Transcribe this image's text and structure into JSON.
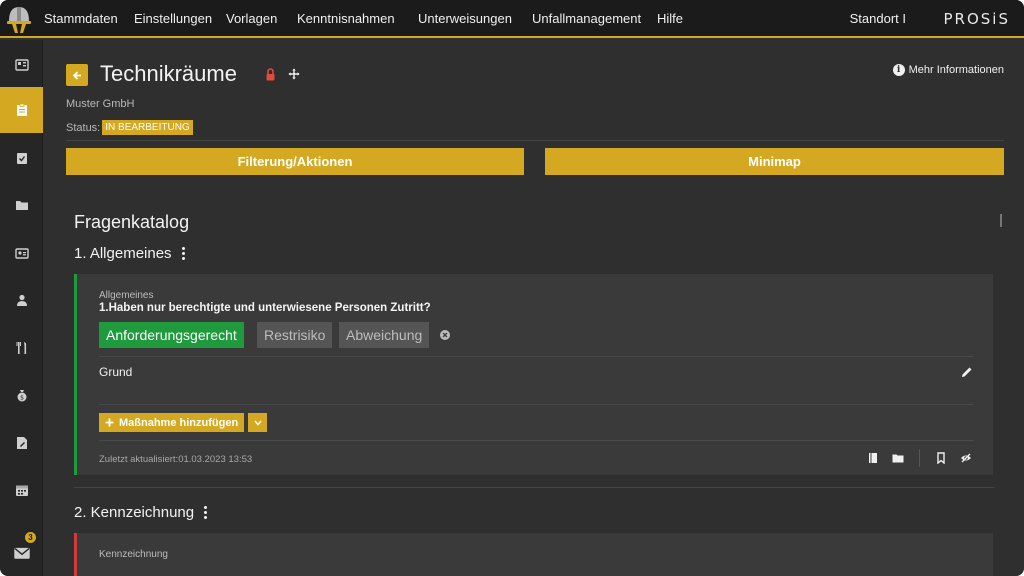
{
  "topbar": {
    "nav": [
      "Stammdaten",
      "Einstellungen",
      "Vorlagen",
      "Kenntnisnahmen",
      "Unterweisungen",
      "Unfallmanagement",
      "Hilfe"
    ],
    "location": "Standort I",
    "brand": "PROSiS"
  },
  "sidebar": {
    "items": [
      "dashboard-icon",
      "clipboard-icon",
      "clipboard-check-icon",
      "folder-icon",
      "id-card-icon",
      "person-icon",
      "tools-icon",
      "money-bag-icon",
      "file-edit-icon",
      "calendar-icon",
      "mail-icon"
    ],
    "active_index": 1,
    "mail_badge": "3"
  },
  "header": {
    "title": "Technikräume",
    "company": "Muster GmbH",
    "status_label": "Status:",
    "status_value": "IN BEARBEITUNG",
    "more_info": "Mehr Informationen"
  },
  "toolbar": {
    "filter_label": "Filterung/Aktionen",
    "minimap_label": "Minimap"
  },
  "catalog": {
    "title": "Fragenkatalog",
    "groups": [
      {
        "title": "1. Allgemeines",
        "question": {
          "category": "Allgemeines",
          "text": "1.Haben nur berechtigte und unterwiesene Personen Zutritt?",
          "answers": [
            "Anforderungsgerecht",
            "Restrisiko",
            "Abweichung"
          ],
          "selected_answer": "Anforderungsgerecht",
          "reason_label": "Grund",
          "add_measure_label": "Maßnahme hinzufügen",
          "last_updated": "Zuletzt aktualisiert:01.03.2023 13:53"
        }
      },
      {
        "title": "2. Kennzeichnung",
        "question": {
          "category": "Kennzeichnung"
        }
      }
    ]
  },
  "colors": {
    "accent": "#d4a820",
    "success": "#1f9a3c",
    "danger": "#d13b3b",
    "background": "#2f2f2f",
    "topbar": "#1b1b1b"
  }
}
